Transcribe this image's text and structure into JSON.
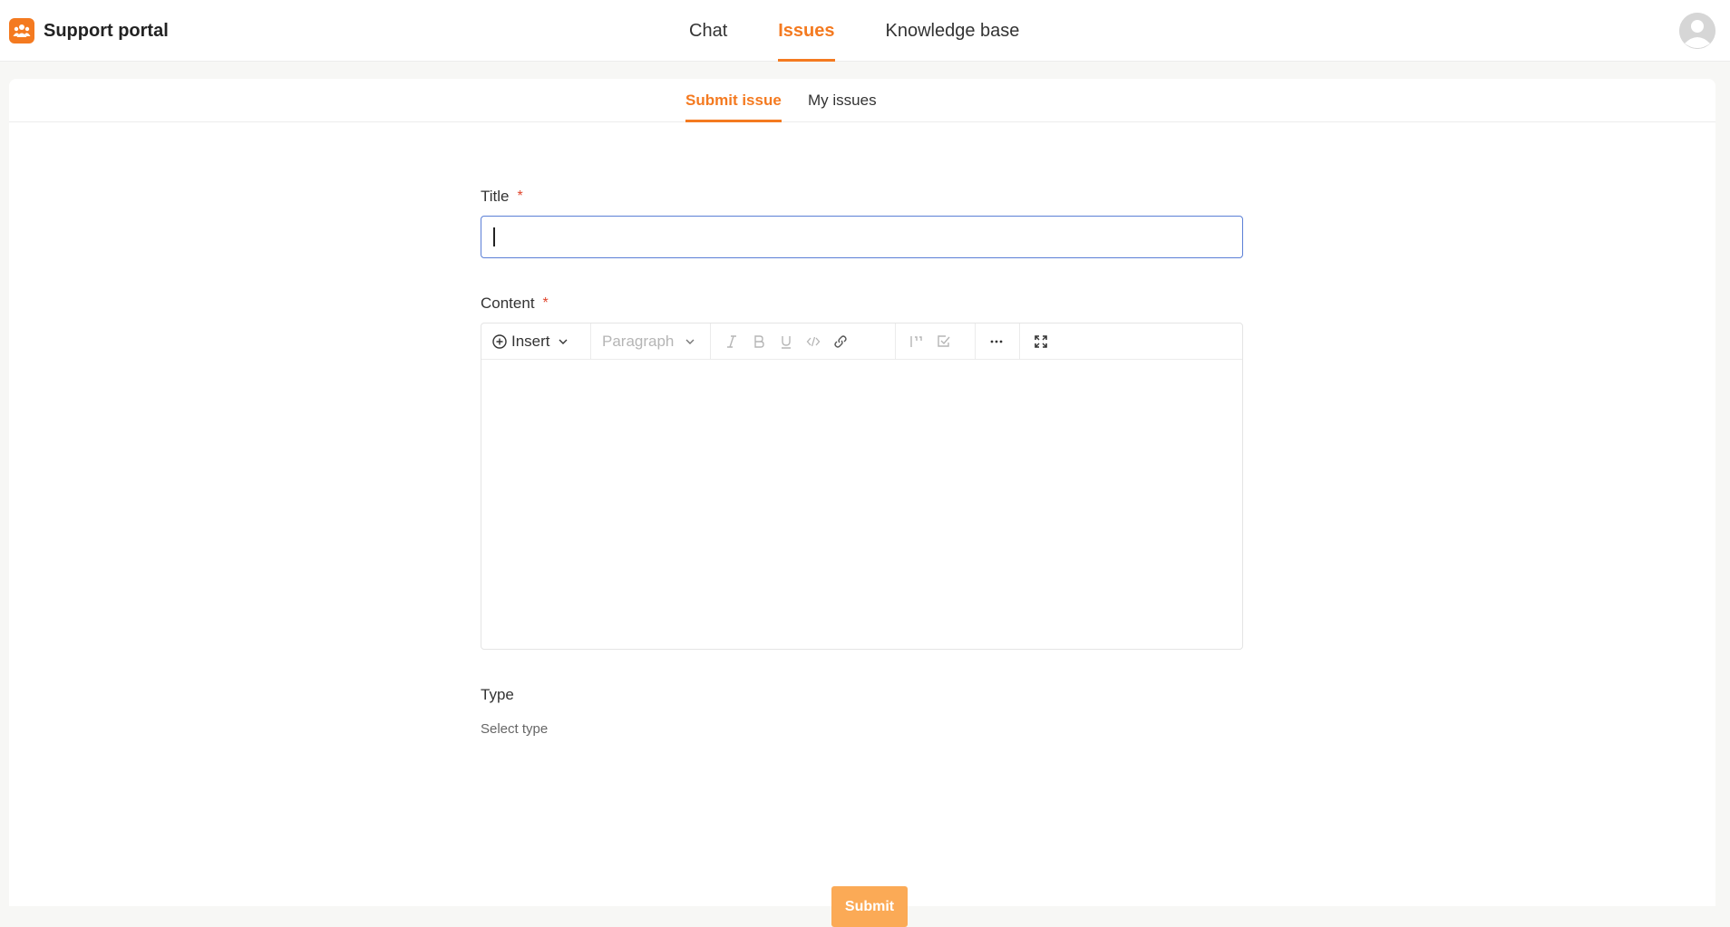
{
  "app": {
    "title": "Support portal",
    "accent_color": "#f47a20"
  },
  "nav": {
    "tabs": [
      {
        "label": "Chat",
        "active": false
      },
      {
        "label": "Issues",
        "active": true
      },
      {
        "label": "Knowledge base",
        "active": false
      }
    ]
  },
  "subtabs": [
    {
      "label": "Submit issue",
      "active": true
    },
    {
      "label": "My issues",
      "active": false
    }
  ],
  "form": {
    "title": {
      "label": "Title",
      "required_mark": "*",
      "value": ""
    },
    "content": {
      "label": "Content",
      "required_mark": "*",
      "toolbar": {
        "insert_label": "Insert",
        "paragraph_label": "Paragraph",
        "icons": [
          "insert-plus-icon",
          "chevron-down-icon",
          "italic-icon",
          "bold-icon",
          "underline-icon",
          "code-icon",
          "link-icon",
          "quote-icon",
          "checklist-icon",
          "more-icon",
          "fullscreen-icon"
        ]
      }
    },
    "type": {
      "label": "Type",
      "placeholder": "Select type"
    },
    "submit_label": "Submit"
  }
}
